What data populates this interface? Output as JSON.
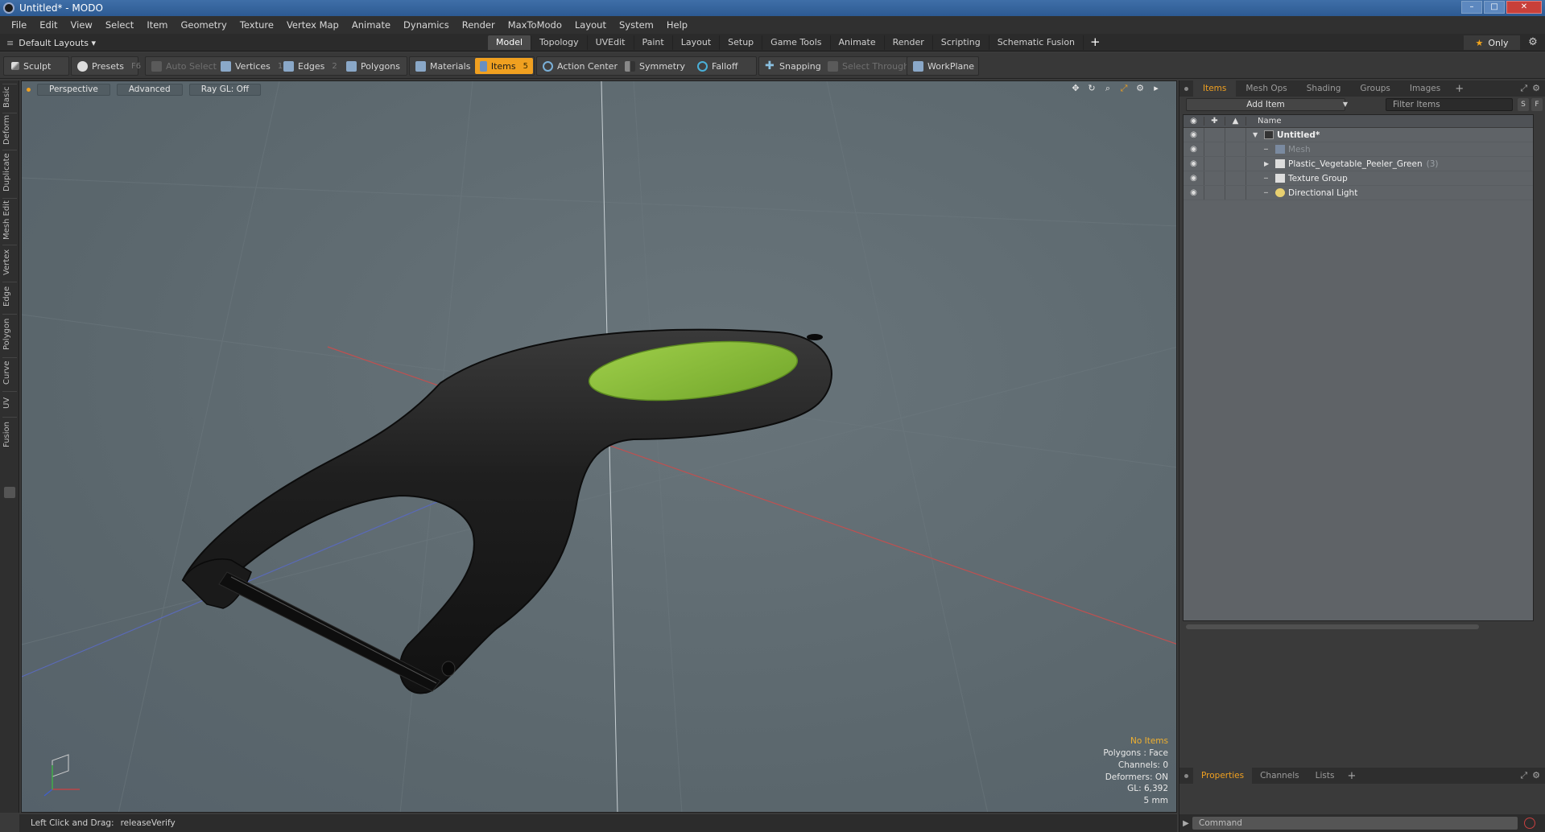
{
  "window": {
    "title": "Untitled* - MODO",
    "buttons": [
      "–",
      "□",
      "✕"
    ]
  },
  "menu": [
    "File",
    "Edit",
    "View",
    "Select",
    "Item",
    "Geometry",
    "Texture",
    "Vertex Map",
    "Animate",
    "Dynamics",
    "Render",
    "MaxToModo",
    "Layout",
    "System",
    "Help"
  ],
  "layout_bar": {
    "layout_name": "Default Layouts ▾",
    "tabs": [
      "Model",
      "Topology",
      "UVEdit",
      "Paint",
      "Layout",
      "Setup",
      "Game Tools",
      "Animate",
      "Render",
      "Scripting",
      "Schematic Fusion"
    ],
    "active_tab": "Model",
    "plus": "+",
    "only_label": "Only"
  },
  "toolbar": {
    "sculpt": "Sculpt",
    "presets": "Presets",
    "presets_key": "F6",
    "auto_select": "Auto Select",
    "vertices": "Vertices",
    "vertices_count": "1",
    "edges": "Edges",
    "edges_count": "2",
    "polygons": "Polygons",
    "materials": "Materials",
    "items": "Items",
    "items_count": "5",
    "action_center": "Action Center",
    "symmetry": "Symmetry",
    "falloff": "Falloff",
    "snapping": "Snapping",
    "select_through": "Select Through",
    "workplane": "WorkPlane"
  },
  "left_tabs": [
    "Basic",
    "Deform",
    "Duplicate",
    "Mesh Edit",
    "Vertex",
    "Edge",
    "Polygon",
    "Curve",
    "UV",
    "Fusion"
  ],
  "viewport": {
    "view_mode": "Perspective",
    "shading": "Advanced",
    "raygl": "Ray GL: Off",
    "stats": {
      "selection": "No Items",
      "polygons": "Polygons : Face",
      "channels": "Channels: 0",
      "deformers": "Deformers: ON",
      "gl": "GL: 6,392",
      "grid": "5 mm"
    }
  },
  "status": {
    "hint": "Left Click and Drag:",
    "action": "releaseVerify"
  },
  "right_panel": {
    "tabs": [
      "Items",
      "Mesh Ops",
      "Shading",
      "Groups",
      "Images"
    ],
    "active_tab": "Items",
    "add_item": "Add Item",
    "filter_placeholder": "Filter Items",
    "s_btn": "S",
    "f_btn": "F",
    "column_name": "Name",
    "tree": [
      {
        "label": "Untitled*",
        "level": 0,
        "expanded": true,
        "bold": true,
        "dim": false,
        "count": ""
      },
      {
        "label": "Mesh",
        "level": 1,
        "expanded": false,
        "bold": false,
        "dim": true,
        "count": ""
      },
      {
        "label": "Plastic_Vegetable_Peeler_Green",
        "level": 1,
        "expanded": false,
        "bold": false,
        "dim": false,
        "count": "(3)"
      },
      {
        "label": "Texture Group",
        "level": 1,
        "expanded": false,
        "bold": false,
        "dim": false,
        "count": ""
      },
      {
        "label": "Directional Light",
        "level": 1,
        "expanded": false,
        "bold": false,
        "dim": false,
        "count": ""
      }
    ],
    "bottom_tabs": [
      "Properties",
      "Channels",
      "Lists"
    ],
    "bottom_active": "Properties",
    "command_placeholder": "Command"
  },
  "colors": {
    "accent": "#f0a020",
    "handle": "#1c1c1c",
    "grip": "#8fc23a",
    "viewport_bg": "#5e6a70"
  }
}
